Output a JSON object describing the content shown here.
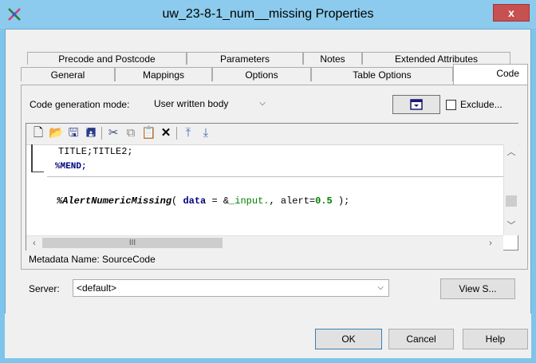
{
  "window": {
    "title": "uw_23-8-1_num__missing Properties",
    "close_label": "x"
  },
  "tabs": {
    "row1": [
      "Precode and Postcode",
      "Parameters",
      "Notes",
      "Extended Attributes"
    ],
    "row2": [
      "General",
      "Mappings",
      "Options",
      "Table Options",
      "Code"
    ],
    "active": "Code"
  },
  "code_panel": {
    "mode_label": "Code generation mode:",
    "mode_value": "User written body",
    "exclude_label": "Exclude..."
  },
  "editor": {
    "lines": [
      "TITLE;TITLE2;",
      "%MEND;",
      "%AlertNumericMissing( data = &_input., alert=0.5 );"
    ],
    "scroll_thumb_label": "III"
  },
  "metadata_name": "Metadata Name: SourceCode",
  "server": {
    "label": "Server:",
    "value": "<default>",
    "view_button": "View S..."
  },
  "footer": {
    "ok": "OK",
    "cancel": "Cancel",
    "help": "Help"
  },
  "colors": {
    "titlebar": "#8ccbed",
    "close": "#c75050",
    "macro_keyword": "#000080",
    "code_green": "#008000"
  }
}
